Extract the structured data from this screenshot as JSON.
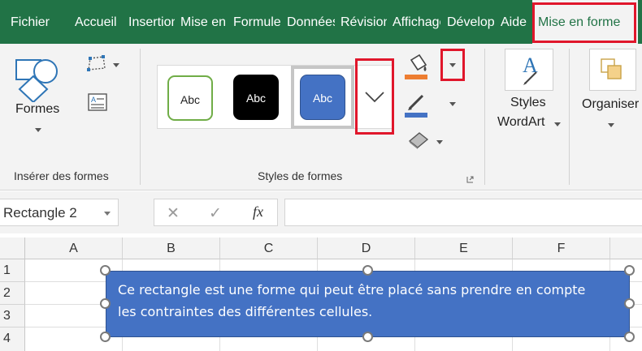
{
  "tabs": [
    {
      "label": "Fichier"
    },
    {
      "label": "Accueil"
    },
    {
      "label": "Insertion"
    },
    {
      "label": "Mise en page"
    },
    {
      "label": "Formules"
    },
    {
      "label": "Données"
    },
    {
      "label": "Révision"
    },
    {
      "label": "Affichage"
    },
    {
      "label": "Développeur"
    },
    {
      "label": "Aide"
    }
  ],
  "active_tab": {
    "label": "Mise en forme"
  },
  "ribbon": {
    "insert_shapes": {
      "formes_label": "Formes",
      "group_label": "Insérer des formes"
    },
    "shape_styles": {
      "swatches": [
        {
          "text": "Abc",
          "fill": "#ffffff",
          "border": "#70ad47",
          "text_color": "#222222"
        },
        {
          "text": "Abc",
          "fill": "#000000",
          "border": "#000000",
          "text_color": "#ffffff"
        },
        {
          "text": "Abc",
          "fill": "#4472c4",
          "border": "#2f528f",
          "text_color": "#ffffff"
        }
      ],
      "group_label": "Styles de formes"
    },
    "wordart": {
      "line1": "Styles",
      "line2": "WordArt"
    },
    "arrange": {
      "label": "Organiser"
    }
  },
  "formula_bar": {
    "name_box": "Rectangle 2",
    "fx_label": "fx",
    "cancel_glyph": "✕",
    "enter_glyph": "✓"
  },
  "grid": {
    "columns": [
      "A",
      "B",
      "C",
      "D",
      "E",
      "F"
    ],
    "rows": [
      "1",
      "2",
      "3",
      "4"
    ]
  },
  "shape": {
    "text": "Ce rectangle est une forme qui peut être placé sans prendre en compte les contraintes des différentes cellules.",
    "fill": "#4472c4"
  },
  "colors": {
    "brand": "#217346",
    "highlight": "#e0162b",
    "fill_accent": "#ed7d31",
    "outline_accent": "#4472c4"
  }
}
